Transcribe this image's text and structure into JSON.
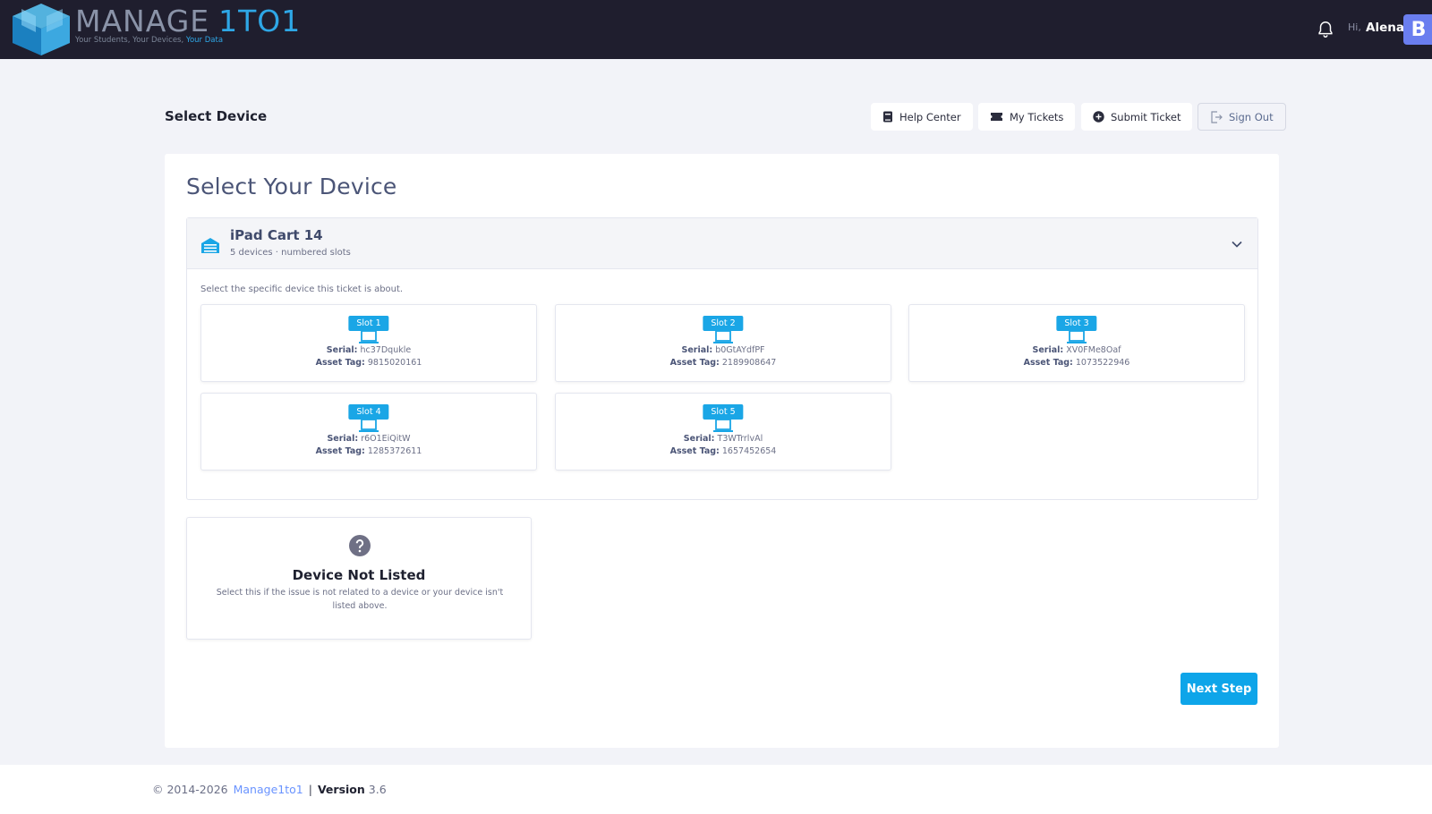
{
  "header": {
    "logo_word1": "MANAGE",
    "logo_word2": "1TO1",
    "tagline_part1": "Your Students, Your Devices,",
    "tagline_part2": "Your Data",
    "greeting": "Hi,",
    "user_name": "Alena",
    "avatar_letter": "B"
  },
  "subheader": {
    "title": "Select Device",
    "buttons": {
      "help_center": "Help Center",
      "my_tickets": "My Tickets",
      "submit_ticket": "Submit Ticket",
      "sign_out": "Sign Out"
    }
  },
  "main": {
    "title": "Select Your Device",
    "cart": {
      "name": "iPad Cart 14",
      "subtitle": "5 devices · numbered slots",
      "help_text": "Select the specific device this ticket is about.",
      "devices": [
        {
          "slot": "Slot 1",
          "serial_label": "Serial:",
          "serial": "hc37Dqukle",
          "tag_label": "Asset Tag:",
          "asset_tag": "9815020161"
        },
        {
          "slot": "Slot 2",
          "serial_label": "Serial:",
          "serial": "b0GtAYdfPF",
          "tag_label": "Asset Tag:",
          "asset_tag": "2189908647"
        },
        {
          "slot": "Slot 3",
          "serial_label": "Serial:",
          "serial": "XV0FMe8Oaf",
          "tag_label": "Asset Tag:",
          "asset_tag": "1073522946"
        },
        {
          "slot": "Slot 4",
          "serial_label": "Serial:",
          "serial": "r6O1EiQitW",
          "tag_label": "Asset Tag:",
          "asset_tag": "1285372611"
        },
        {
          "slot": "Slot 5",
          "serial_label": "Serial:",
          "serial": "T3WTrrlvAl",
          "tag_label": "Asset Tag:",
          "asset_tag": "1657452654"
        }
      ]
    },
    "not_listed": {
      "title": "Device Not Listed",
      "description": "Select this if the issue is not related to a device or your device isn't listed above."
    },
    "next_button": "Next Step"
  },
  "footer": {
    "copyright": "© 2014-2026",
    "brand": "Manage1to1",
    "separator": "|",
    "version_label": "Version",
    "version": "3.6"
  },
  "colors": {
    "topbar": "#1f1e2e",
    "accent": "#1aa6e6",
    "primary_button": "#0ea5e9",
    "avatar": "#6a7eef",
    "link": "#6993ff"
  },
  "icons": {
    "notification": "bell-icon",
    "help_center": "book-icon",
    "my_tickets": "ticket-icon",
    "submit_ticket": "plus-circle-icon",
    "sign_out": "sign-out-icon",
    "cart": "cart-icon",
    "expand": "chevron-down-icon",
    "device": "laptop-icon",
    "not_listed": "question-circle-icon"
  }
}
